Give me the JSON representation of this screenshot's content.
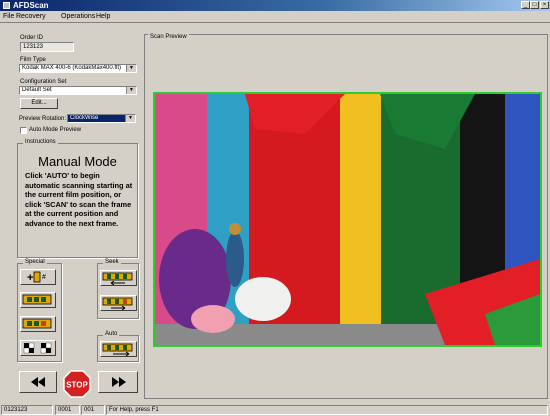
{
  "window": {
    "title": "AFDScan"
  },
  "menu": [
    "File",
    "Recovery",
    "Operations",
    "Help"
  ],
  "order": {
    "label": "Order ID",
    "value": "123123"
  },
  "film": {
    "label": "Film Type",
    "value": "Kodak MAX 400-6 (KodakMax400.flt)"
  },
  "config": {
    "label": "Configuration Set",
    "value": "Default Set",
    "edit_label": "Edit..."
  },
  "rotation": {
    "label": "Preview Rotation:",
    "value": "ClockWise"
  },
  "auto_preview": {
    "label": "Auto Mode Preview",
    "checked": false
  },
  "instructions": {
    "group_label": "Instructions",
    "title": "Manual Mode",
    "body": "Click 'AUTO' to begin automatic scanning starting at the current film position, or click 'SCAN' to scan the frame at the current position and advance to the next frame."
  },
  "groups": {
    "special": "Special",
    "seek": "Seek",
    "auto": "Auto"
  },
  "preview": {
    "label": "Scan Preview"
  },
  "icons": {
    "add_frame": "add-frame-icon",
    "scan_frame": "scan-frame-icon",
    "scan_film": "scan-film-icon",
    "checkerboard": "checkerboard-icon",
    "seek_back": "seek-back-icon",
    "seek_forward": "seek-forward-icon",
    "auto_scan": "auto-scan-icon",
    "rewind": "rewind-icon",
    "stop": "stop-icon",
    "fast_forward": "fast-forward-icon"
  },
  "stop_label": "STOP",
  "status": {
    "order": "0123123",
    "roll": "0001",
    "frame": "001",
    "help": "For Help, press F1"
  },
  "colors": {
    "title_start": "#0a246a",
    "title_end": "#a6caf0",
    "preview_border": "#2ecc2e",
    "stop_red": "#d42020"
  }
}
